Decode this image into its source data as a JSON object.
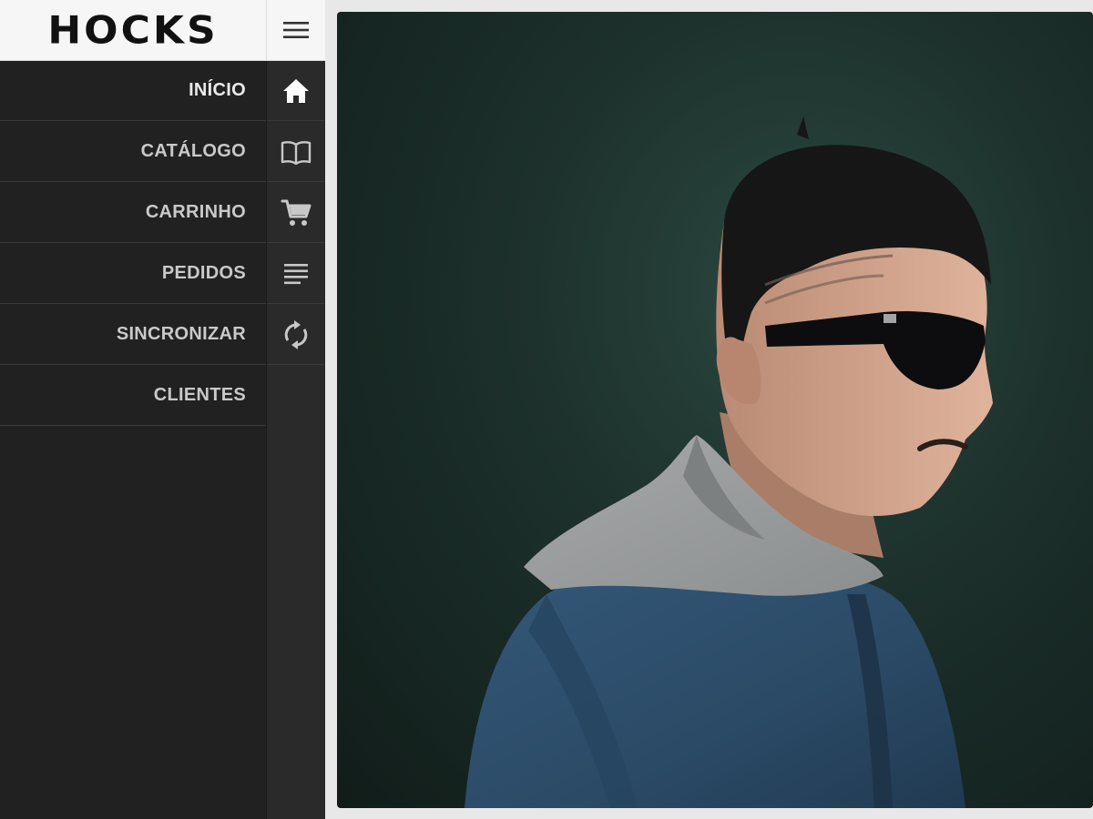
{
  "brand": {
    "logo_text": "HOCKS"
  },
  "header": {
    "menu_icon": "hamburger-menu-icon"
  },
  "sidebar": {
    "items": [
      {
        "label": "INÍCIO",
        "icon": "home-icon"
      },
      {
        "label": "CATÁLOGO",
        "icon": "book-icon"
      },
      {
        "label": "CARRINHO",
        "icon": "cart-icon"
      },
      {
        "label": "PEDIDOS",
        "icon": "list-icon"
      },
      {
        "label": "SINCRONIZAR",
        "icon": "sync-icon"
      },
      {
        "label": "CLIENTES",
        "icon": ""
      }
    ]
  },
  "colors": {
    "sidebar_bg": "#212121",
    "rail_bg": "#2a2a2a",
    "topbar_bg": "#f6f6f6",
    "label_text": "#c9c9c9",
    "icon_color": "#c8c8c8",
    "photo_bg": "#1c302b"
  }
}
